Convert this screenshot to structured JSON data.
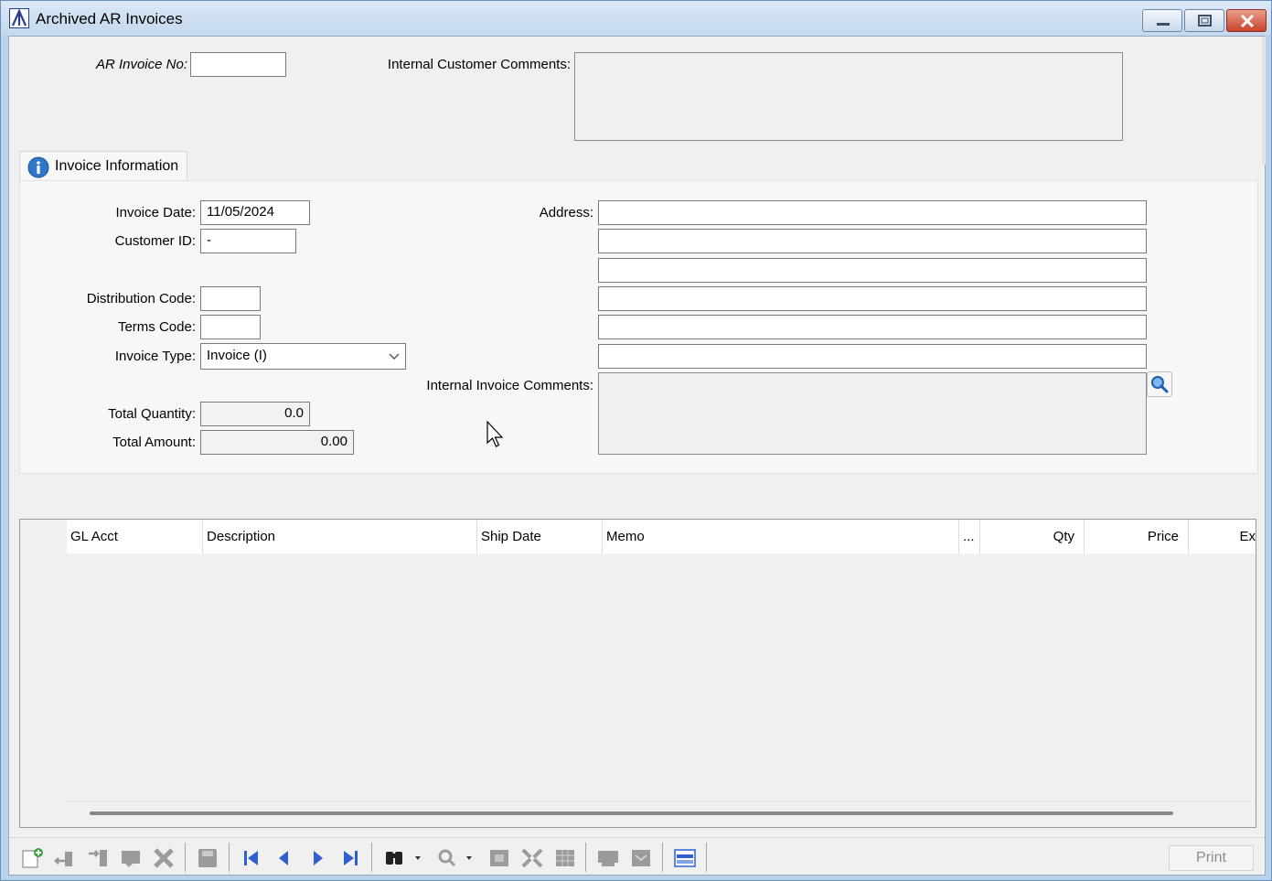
{
  "window": {
    "title": "Archived AR Invoices"
  },
  "header": {
    "ar_invoice_no_label": "AR Invoice No:",
    "ar_invoice_no_value": "",
    "internal_customer_comments_label": "Internal Customer Comments:",
    "internal_customer_comments_value": ""
  },
  "tab": {
    "label": "Invoice Information",
    "icon": "info-icon"
  },
  "form": {
    "invoice_date_label": "Invoice Date:",
    "invoice_date_value": "11/05/2024",
    "customer_id_label": "Customer ID:",
    "customer_id_value": "-",
    "distribution_code_label": "Distribution Code:",
    "distribution_code_value": "",
    "terms_code_label": "Terms Code:",
    "terms_code_value": "",
    "invoice_type_label": "Invoice Type:",
    "invoice_type_value": "Invoice (I)",
    "total_quantity_label": "Total Quantity:",
    "total_quantity_value": "0.0",
    "total_amount_label": "Total Amount:",
    "total_amount_value": "0.00",
    "address_label": "Address:",
    "address_lines": [
      "",
      "",
      "",
      "",
      "",
      ""
    ],
    "internal_invoice_comments_label": "Internal Invoice Comments:",
    "internal_invoice_comments_value": ""
  },
  "grid": {
    "columns": [
      "GL Acct",
      "Description",
      "Ship Date",
      "Memo",
      "...",
      "Qty",
      "Price",
      "Ex"
    ],
    "rows": []
  },
  "toolbar": {
    "print_label": "Print",
    "icons": [
      "new-record-icon",
      "add-row-icon",
      "insert-row-icon",
      "edit-icon",
      "delete-icon",
      "save-icon",
      "first-record-icon",
      "previous-record-icon",
      "next-record-icon",
      "last-record-icon",
      "find-binoculars-icon",
      "zoom-icon",
      "grid-view-icon",
      "expand-icon",
      "table-icon",
      "report-icon",
      "archive-icon",
      "layout-icon"
    ]
  },
  "colors": {
    "titlebar": "#c3d8ee",
    "close_button": "#c8422b",
    "nav_blue": "#2f5fd0",
    "panel": "#f0f0f0"
  }
}
